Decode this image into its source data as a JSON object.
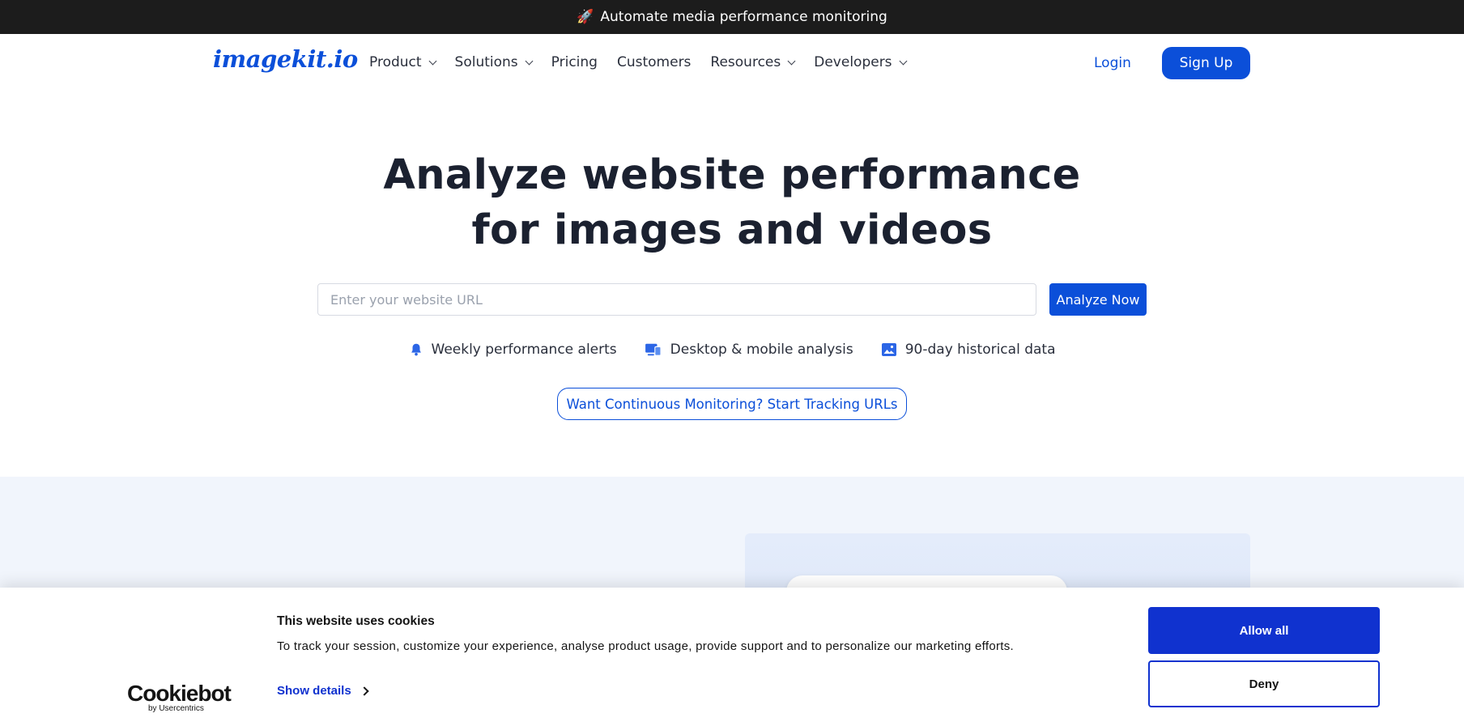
{
  "announcement": {
    "icon": "rocket-icon",
    "text": "Automate media performance monitoring"
  },
  "nav": {
    "logo": "imagekit.io",
    "items": [
      {
        "label": "Product",
        "has_dropdown": true
      },
      {
        "label": "Solutions",
        "has_dropdown": true
      },
      {
        "label": "Pricing",
        "has_dropdown": false
      },
      {
        "label": "Customers",
        "has_dropdown": false
      },
      {
        "label": "Resources",
        "has_dropdown": true
      },
      {
        "label": "Developers",
        "has_dropdown": true
      }
    ],
    "login": "Login",
    "signup": "Sign Up"
  },
  "hero": {
    "title_line1": "Analyze website performance",
    "title_line2": "for images and videos",
    "url_placeholder": "Enter your website URL",
    "url_value": "",
    "analyze_button": "Analyze Now",
    "features": [
      {
        "icon": "bell-icon",
        "label": "Weekly performance alerts"
      },
      {
        "icon": "devices-icon",
        "label": "Desktop & mobile analysis"
      },
      {
        "icon": "image-icon",
        "label": "90-day historical data"
      }
    ],
    "tracking_button": "Want Continuous Monitoring? Start Tracking URLs"
  },
  "cookie_banner": {
    "brand": "Cookiebot",
    "brand_sub": "by Usercentrics",
    "title": "This website uses cookies",
    "text": "To track your session, customize your experience, analyse product usage, provide support and to personalize our marketing efforts.",
    "show_details": "Show details",
    "allow_all": "Allow all",
    "deny": "Deny"
  },
  "colors": {
    "brand_blue": "#0b4fd9",
    "cookie_blue": "#1032cf",
    "topbar_bg": "#1c1c1c",
    "band_bg": "#f1f5fc"
  }
}
